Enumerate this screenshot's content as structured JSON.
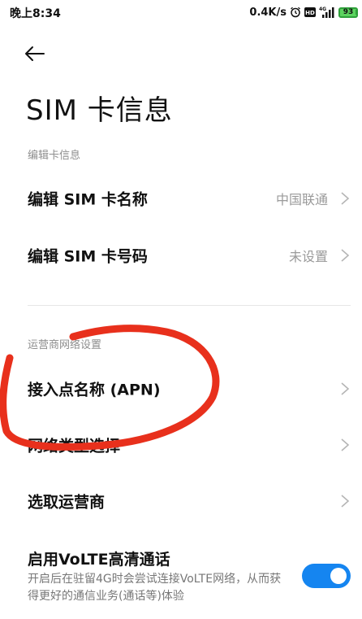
{
  "status_bar": {
    "time": "晚上8:34",
    "net_speed": "0.4K/s",
    "network_type": "4G",
    "hd_label": "HD",
    "battery": "93",
    "icons": [
      "alarm-icon",
      "hd-icon",
      "signal-icon",
      "battery-icon"
    ]
  },
  "header": {
    "back_icon": "arrow-left-icon",
    "title": "SIM 卡信息"
  },
  "sections": {
    "edit_card": {
      "header": "编辑卡信息",
      "rows": [
        {
          "label": "编辑 SIM 卡名称",
          "value": "中国联通"
        },
        {
          "label": "编辑 SIM 卡号码",
          "value": "未设置"
        }
      ]
    },
    "carrier": {
      "header": "运营商网络设置",
      "rows": [
        {
          "label": "接入点名称 (APN)"
        },
        {
          "label": "网络类型选择"
        },
        {
          "label": "选取运营商"
        }
      ]
    }
  },
  "volte": {
    "title": "启用VoLTE高清通话",
    "description": "开启后在驻留4G时会尝试连接VoLTE网络，从而获得更好的通信业务(通话等)体验",
    "enabled": true
  },
  "colors": {
    "accent": "#1585f0",
    "annotation": "#e8301c",
    "section_header": "#8e8e8e",
    "value_text": "#9a9a9a"
  }
}
